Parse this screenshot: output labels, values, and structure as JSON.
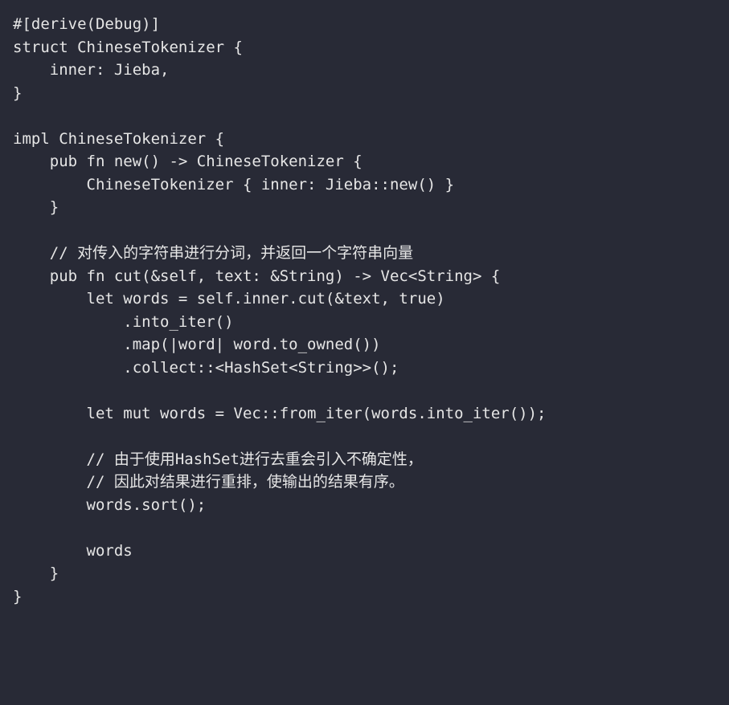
{
  "code": {
    "lines": [
      "#[derive(Debug)]",
      "struct ChineseTokenizer {",
      "    inner: Jieba,",
      "}",
      "",
      "impl ChineseTokenizer {",
      "    pub fn new() -> ChineseTokenizer {",
      "        ChineseTokenizer { inner: Jieba::new() }",
      "    }",
      "",
      "    // 对传入的字符串进行分词，并返回一个字符串向量",
      "    pub fn cut(&self, text: &String) -> Vec<String> {",
      "        let words = self.inner.cut(&text, true)",
      "            .into_iter()",
      "            .map(|word| word.to_owned())",
      "            .collect::<HashSet<String>>();",
      "",
      "        let mut words = Vec::from_iter(words.into_iter());",
      "",
      "        // 由于使用HashSet进行去重会引入不确定性，",
      "        // 因此对结果进行重排，使输出的结果有序。",
      "        words.sort();",
      "",
      "        words",
      "    }",
      "}"
    ]
  }
}
